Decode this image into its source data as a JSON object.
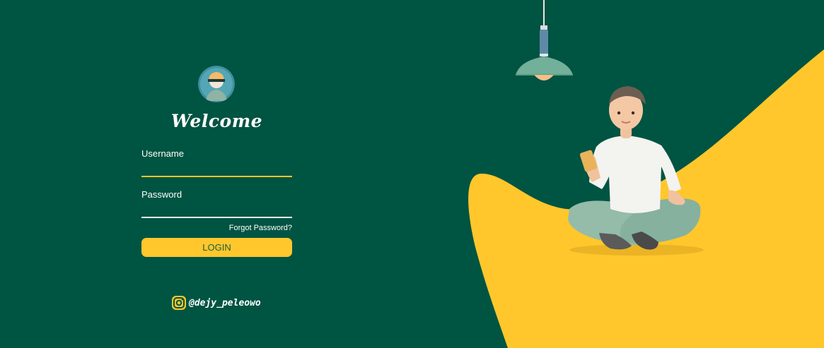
{
  "login": {
    "title": "Welcome",
    "username_label": "Username",
    "username_value": "",
    "password_label": "Password",
    "password_value": "",
    "forgot_label": "Forgot Password?",
    "login_label": "LOGIN"
  },
  "social": {
    "icon": "instagram-icon",
    "handle": "@dejy_peleowo"
  },
  "colors": {
    "background": "#005442",
    "accent": "#ffc72c",
    "text": "#ffffff"
  }
}
